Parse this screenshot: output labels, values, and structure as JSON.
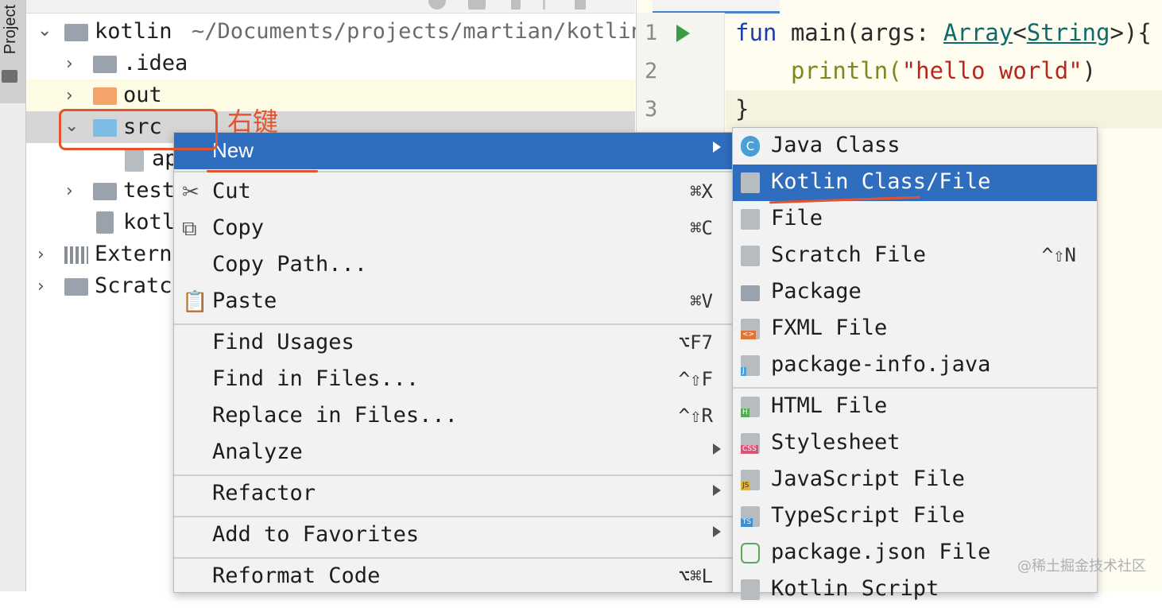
{
  "toolstrip": {
    "project_label": "Project"
  },
  "tree": {
    "root": {
      "name": "kotlin",
      "path": "~/Documents/projects/martian/kotlin"
    },
    "items": [
      {
        "label": ".idea"
      },
      {
        "label": "out"
      },
      {
        "label": "src"
      },
      {
        "label": "ap"
      },
      {
        "label": "test"
      },
      {
        "label": "kotl"
      },
      {
        "label": "Externa"
      },
      {
        "label": "Scratch"
      }
    ]
  },
  "editor": {
    "lines": [
      {
        "num": "1",
        "kw": "fun ",
        "name": "main(args: ",
        "type1": "Array",
        "lt": "<",
        "type2": "String",
        "rest": ">){"
      },
      {
        "num": "2",
        "call": "println(",
        "str": "\"hello world\"",
        "close": ")"
      },
      {
        "num": "3",
        "text": "}"
      }
    ]
  },
  "context_menu": {
    "items": [
      {
        "label": "New",
        "shortcut": ""
      },
      {
        "label": "Cut",
        "shortcut": "⌘X"
      },
      {
        "label": "Copy",
        "shortcut": "⌘C"
      },
      {
        "label": "Copy Path...",
        "shortcut": ""
      },
      {
        "label": "Paste",
        "shortcut": "⌘V"
      },
      {
        "label": "Find Usages",
        "shortcut": "⌥F7"
      },
      {
        "label": "Find in Files...",
        "shortcut": "^⇧F"
      },
      {
        "label": "Replace in Files...",
        "shortcut": "^⇧R"
      },
      {
        "label": "Analyze",
        "shortcut": ""
      },
      {
        "label": "Refactor",
        "shortcut": ""
      },
      {
        "label": "Add to Favorites",
        "shortcut": ""
      },
      {
        "label": "Reformat Code",
        "shortcut": "⌥⌘L"
      }
    ]
  },
  "submenu": {
    "items": [
      {
        "label": "Java Class",
        "shortcut": ""
      },
      {
        "label": "Kotlin Class/File",
        "shortcut": ""
      },
      {
        "label": "File",
        "shortcut": ""
      },
      {
        "label": "Scratch File",
        "shortcut": "^⇧N"
      },
      {
        "label": "Package",
        "shortcut": ""
      },
      {
        "label": "FXML File",
        "shortcut": ""
      },
      {
        "label": "package-info.java",
        "shortcut": ""
      },
      {
        "label": "HTML File",
        "shortcut": ""
      },
      {
        "label": "Stylesheet",
        "shortcut": ""
      },
      {
        "label": "JavaScript File",
        "shortcut": ""
      },
      {
        "label": "TypeScript File",
        "shortcut": ""
      },
      {
        "label": "package.json File",
        "shortcut": ""
      },
      {
        "label": "Kotlin Script",
        "shortcut": ""
      }
    ]
  },
  "icon_badges": {
    "fxml": "<>",
    "pkginfo": "J",
    "html": "H",
    "css": "CSS",
    "js": "JS",
    "ts": "TS",
    "java": "C"
  },
  "annotation": {
    "right_click": "右键"
  },
  "watermark": "@稀土掘金技术社区",
  "colors": {
    "selection": "#2f6dbf",
    "annotation": "#e2532e",
    "editor_bg": "#fefdf0"
  }
}
